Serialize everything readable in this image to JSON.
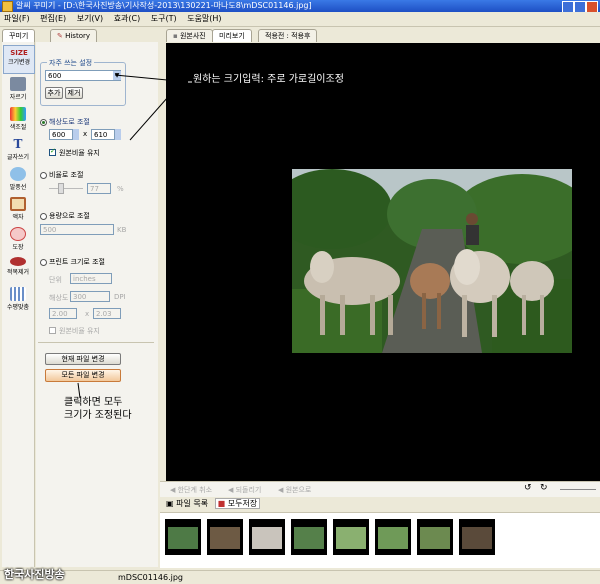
{
  "window": {
    "title": "알씨 꾸미기 - [D:\\한국사진방송\\기사작성-2013\\130221-마나도8\\mDSC01146.jpg]"
  },
  "menu": [
    "파일(F)",
    "편집(E)",
    "보기(V)",
    "효과(C)",
    "도구(T)",
    "도움말(H)"
  ],
  "left_tabs": {
    "decorate": "꾸미기",
    "history": "History"
  },
  "tools": [
    "크기변경",
    "자르기",
    "색조절",
    "글자쓰기",
    "말풍선",
    "액자",
    "도장",
    "적목제거",
    "수평맞춤"
  ],
  "tool_badge": "SIZE",
  "resize": {
    "frequent_label": "자주 쓰는 설정",
    "frequent_value": "600",
    "add_label": "추가",
    "remove_label": "제거",
    "resolution_label": "해상도로 조절",
    "width": "600",
    "x": "x",
    "height": "610",
    "keep_ratio": "원본비율 유지",
    "ratio_label": "비율로 조절",
    "ratio_value": "77",
    "percent": "%",
    "capacity_label": "용량으로 조절",
    "capacity_value": "500",
    "kb": "KB",
    "print_label": "프린트 크기로 조절",
    "unit_label": "단위",
    "unit_value": "inches",
    "resolution_field_label": "해상도",
    "dpi_value": "300",
    "dpi": "DPI",
    "print_w": "2.00",
    "print_h": "2.03",
    "print_keep_ratio": "원본비율 유지",
    "apply_current": "현재 파일 변경",
    "apply_all": "모든 파일 변경"
  },
  "view_tabs": [
    "원본사진",
    "미리보기",
    "적용전 : 적용후"
  ],
  "annotations": {
    "top": "원하는 크기입력: 주로 가로길이조정",
    "bottom_line1": "클릭하면 모두",
    "bottom_line2": "크기가 조정된다"
  },
  "viewer_actions": [
    "한단계 취소",
    "되돌리기",
    "원본으로"
  ],
  "file_list": {
    "label": "파일 목록",
    "save_all": "모두저장"
  },
  "status": {
    "watermark": "한국사진방송",
    "filename": "mDSC01146.jpg"
  },
  "colors": {
    "accent": "#1e4fc4",
    "annotation_line": "#000000"
  }
}
